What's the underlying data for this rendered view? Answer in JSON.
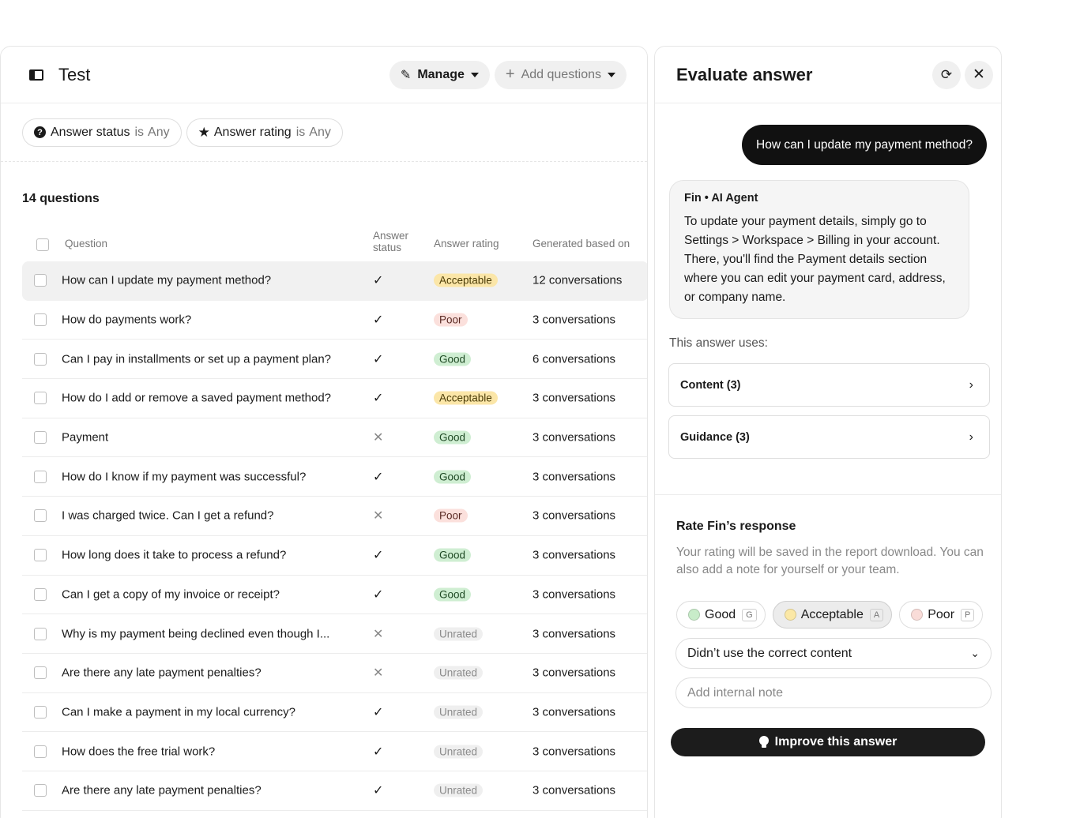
{
  "left": {
    "title": "Test",
    "manage_label": "Manage",
    "add_label": "Add questions",
    "filters": [
      {
        "name": "Answer status",
        "op": "is",
        "value": "Any"
      },
      {
        "name": "Answer rating",
        "op": "is",
        "value": "Any"
      }
    ],
    "count": "14 questions",
    "columns": {
      "question": "Question",
      "status_1": "Answer",
      "status_2": "status",
      "rating": "Answer rating",
      "generated": "Generated based on"
    },
    "rows": [
      {
        "q": "How can I update my payment method?",
        "status": "ok",
        "rating": "Acceptable",
        "gen": "12 conversations"
      },
      {
        "q": "How do payments work?",
        "status": "ok",
        "rating": "Poor",
        "gen": "3 conversations"
      },
      {
        "q": "Can I pay in installments or set up a payment plan?",
        "status": "ok",
        "rating": "Good",
        "gen": "6 conversations"
      },
      {
        "q": "How do I add or remove a saved payment method?",
        "status": "ok",
        "rating": "Acceptable",
        "gen": "3 conversations"
      },
      {
        "q": "Payment",
        "status": "no",
        "rating": "Good",
        "gen": "3 conversations"
      },
      {
        "q": "How do I know if my payment was successful?",
        "status": "ok",
        "rating": "Good",
        "gen": "3 conversations"
      },
      {
        "q": "I was charged twice. Can I get a refund?",
        "status": "no",
        "rating": "Poor",
        "gen": "3 conversations"
      },
      {
        "q": "How long does it take to process a refund?",
        "status": "ok",
        "rating": "Good",
        "gen": "3 conversations"
      },
      {
        "q": "Can I get a copy of my invoice or receipt?",
        "status": "ok",
        "rating": "Good",
        "gen": "3 conversations"
      },
      {
        "q": "Why is my payment being declined even though I...",
        "status": "no",
        "rating": "Unrated",
        "gen": "3 conversations"
      },
      {
        "q": "Are there any late payment penalties?",
        "status": "no",
        "rating": "Unrated",
        "gen": "3 conversations"
      },
      {
        "q": "Can I make a payment in my local currency?",
        "status": "ok",
        "rating": "Unrated",
        "gen": "3 conversations"
      },
      {
        "q": "How does the free trial work?",
        "status": "ok",
        "rating": "Unrated",
        "gen": "3 conversations"
      },
      {
        "q": "Are there any late payment penalties?",
        "status": "ok",
        "rating": "Unrated",
        "gen": "3 conversations"
      }
    ]
  },
  "right": {
    "title": "Evaluate answer",
    "user_question": "How can I update my payment method?",
    "agent_name": "Fin • AI Agent",
    "agent_answer": "To update your payment details, simply go to Settings > Workspace > Billing in your account. There, you'll find the Payment details section where you can edit your payment card, address, or company name.",
    "uses_label": "This answer uses:",
    "content_label": "Content (3)",
    "guidance_label": "Guidance (3)",
    "rate_heading": "Rate Fin’s response",
    "rate_desc": "Your rating will be saved in the report download. You can also add a note for yourself or your team.",
    "ratings": [
      {
        "label": "Good",
        "key": "G",
        "color": "#c8ecc9"
      },
      {
        "label": "Acceptable",
        "key": "A",
        "color": "#fbe8a6"
      },
      {
        "label": "Poor",
        "key": "P",
        "color": "#f9dcd8"
      }
    ],
    "reason_value": "Didn’t use the correct content",
    "note_placeholder": "Add internal note",
    "improve_label": "Improve this answer"
  }
}
